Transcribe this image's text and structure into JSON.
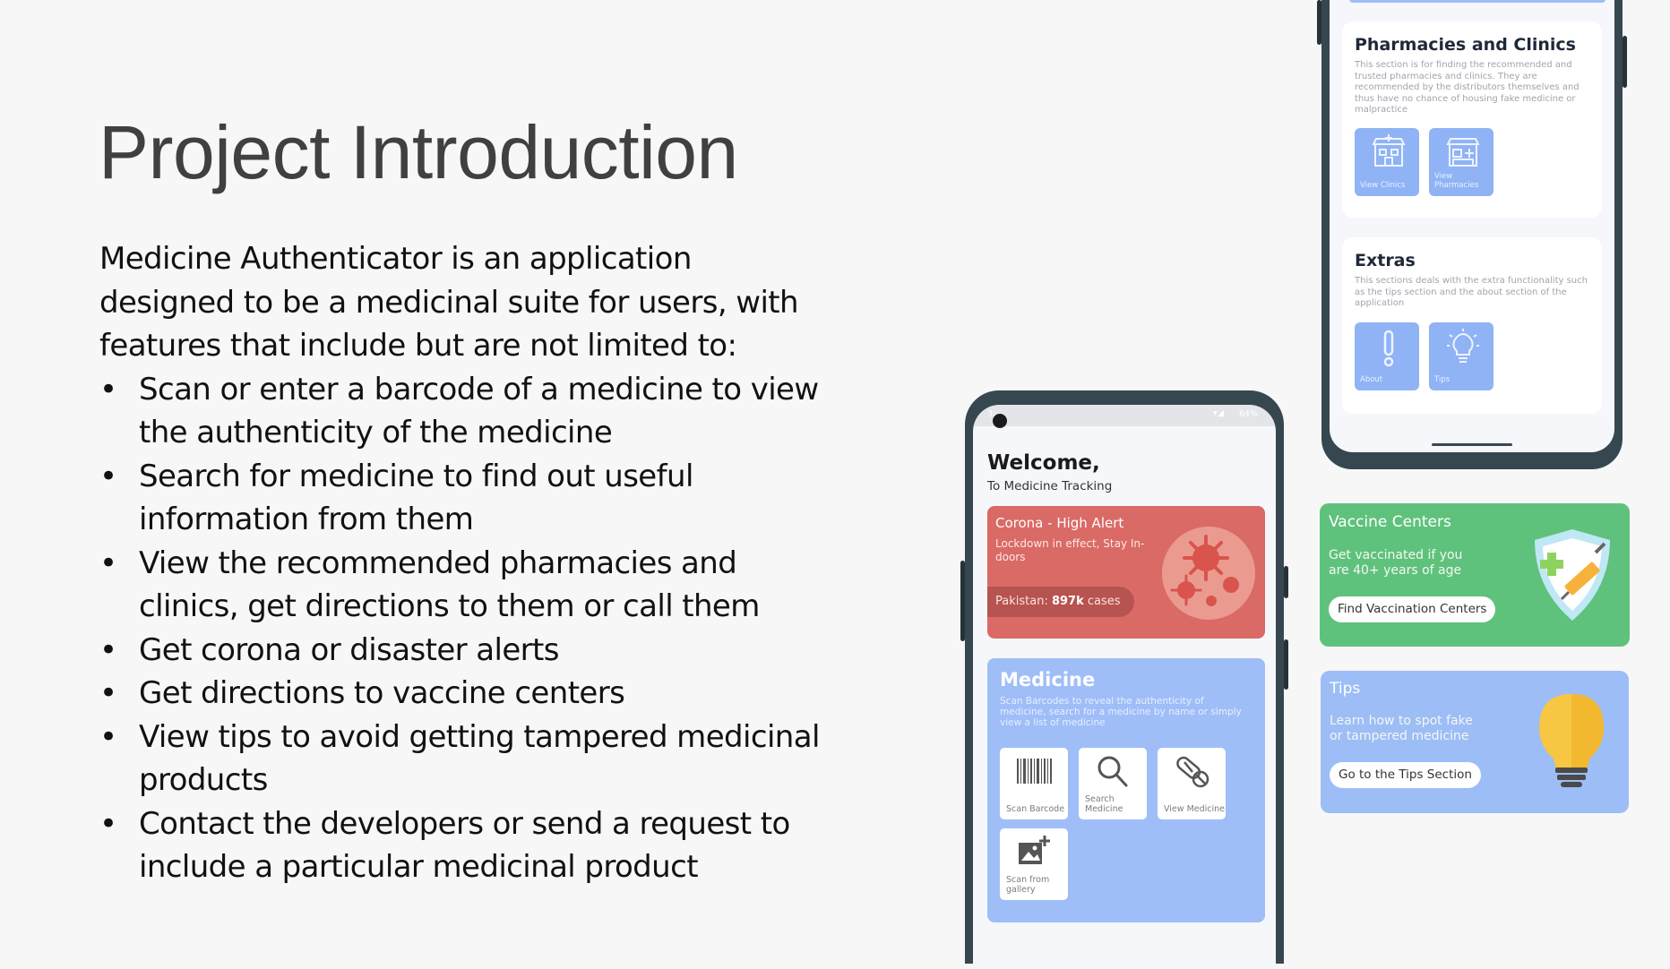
{
  "slide": {
    "title": "Project Introduction",
    "intro": "Medicine Authenticator is an application designed to be a medicinal suite for users, with features that include but are not limited to:",
    "bullets": [
      "Scan or enter a barcode of a medicine to view the authenticity of the medicine",
      "Search for medicine to find out useful information from them",
      "View the recommended pharmacies and clinics, get directions to them or call them",
      "Get corona or disaster alerts",
      "Get directions to vaccine centers",
      "View tips to avoid getting tampered medicinal products",
      "Contact the developers or send a request to include a particular medicinal product"
    ]
  },
  "top_phone": {
    "pharmacies": {
      "title": "Pharmacies and Clinics",
      "description": "This section is for finding the recommended and trusted pharmacies and clinics. They are recommended by the distributors themselves and thus have no chance of housing fake medicine or malpractice",
      "tiles": [
        "View Clinics",
        "View Pharmacies"
      ]
    },
    "extras": {
      "title": "Extras",
      "description": "This sections deals with the extra functionality such as the tips section and the about section of the application",
      "tiles": [
        "About",
        "Tips"
      ]
    }
  },
  "main_phone": {
    "status_left": "3:",
    "status_right": "64%",
    "welcome": "Welcome,",
    "welcome_sub": "To Medicine Tracking",
    "alert": {
      "title": "Corona - High Alert",
      "text": "Lockdown in effect, Stay In-doors",
      "stat_prefix": "Pakistan:",
      "stat_value": "897k",
      "stat_suffix": "cases"
    },
    "medicine": {
      "title": "Medicine",
      "description": "Scan Barcodes to reveal the authenticity of medicine, search for a medicine by name or simply view a list of medicine",
      "tiles": [
        "Scan Barcode",
        "Search Medicine",
        "View Medicine",
        "Scan from gallery"
      ]
    }
  },
  "vaccine_card": {
    "title": "Vaccine Centers",
    "text": "Get vaccinated if you are 40+ years of age",
    "button": "Find Vaccination Centers",
    "color": "#5fc27c"
  },
  "tips_card": {
    "title": "Tips",
    "text": "Learn how to spot fake or tampered medicine",
    "button": "Go to the Tips Section",
    "color": "#9dbdf6"
  },
  "icons": [
    "clinic-icon",
    "pharmacy-icon",
    "exclamation-icon",
    "lightbulb-icon",
    "barcode-icon",
    "search-icon",
    "pill-icon",
    "gallery-add-icon",
    "shield-syringe-icon",
    "virus-icon"
  ]
}
